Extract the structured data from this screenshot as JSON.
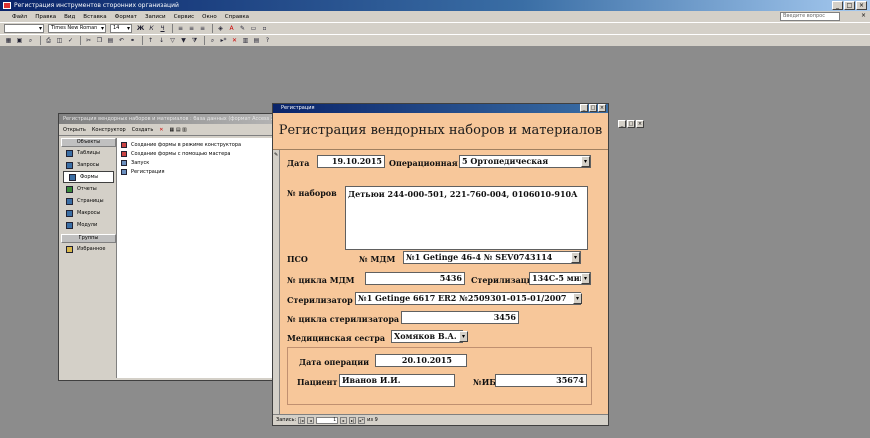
{
  "app": {
    "title": "Регистрация инструментов сторонних организаций",
    "controls": [
      "_",
      "□",
      "×"
    ]
  },
  "menubar": {
    "items": [
      "Файл",
      "Правка",
      "Вид",
      "Вставка",
      "Формат",
      "Записи",
      "Сервис",
      "Окно",
      "Справка"
    ],
    "help_placeholder": "Введите вопрос"
  },
  "toolbar": {
    "font_name": "Times New Roman",
    "font_size": "14",
    "bold": "Ж",
    "italic": "К",
    "underline": "Ч"
  },
  "db_window": {
    "title": "Регистрация вендорных наборов и материалов : база данных (формат Access 2000)",
    "toolbar": [
      "Открыть",
      "Конструктор",
      "Создать"
    ],
    "nav_header": "Объекты",
    "nav_items": [
      "Таблицы",
      "Запросы",
      "Формы",
      "Отчеты",
      "Страницы",
      "Макросы",
      "Модули"
    ],
    "groups_header": "Группы",
    "groups_items": [
      "Избранное"
    ],
    "list_items": [
      "Создание формы в режиме конструктора",
      "Создание формы с помощью мастера",
      "Запуск",
      "Регистрация"
    ]
  },
  "form": {
    "window_title": "Регистрация",
    "heading": "Регистрация вендорных наборов и материалов",
    "date_label": "Дата",
    "date_value": "19.10.2015",
    "operating_label": "Операционная",
    "operating_value": "5 Ортопедическая",
    "sets_label": "№ наборов",
    "sets_value": "Детьюи 244-000-501, 221-760-004, 0106010-910A",
    "pso_label": "ПСО",
    "mdm_label": "№ МДМ",
    "mdm_value": "№1 Getinge 46-4 № SEV0743114",
    "mdm_cycle_label": "№ цикла МДМ",
    "mdm_cycle_value": "5436",
    "sterilization_label": "Стерилизация",
    "sterilization_value": "134C-5 мин.",
    "sterilizer_label": "Стерилизатор",
    "sterilizer_value": "№1 Getinge 6617 ER2 №2509301-015-01/2007",
    "sterilizer_cycle_label": "№ цикла стерилизатора",
    "sterilizer_cycle_value": "3456",
    "nurse_label": "Медицинская сестра",
    "nurse_value": "Хомяков В.А.",
    "operation_date_label": "Дата операции",
    "operation_date_value": "20.10.2015",
    "patient_label": "Пациент",
    "patient_value": "Иванов И.И.",
    "nib_label": "№ИБ",
    "nib_value": "35674",
    "nav_label": "Запись:",
    "nav_current": "1",
    "nav_total": "из 9"
  }
}
